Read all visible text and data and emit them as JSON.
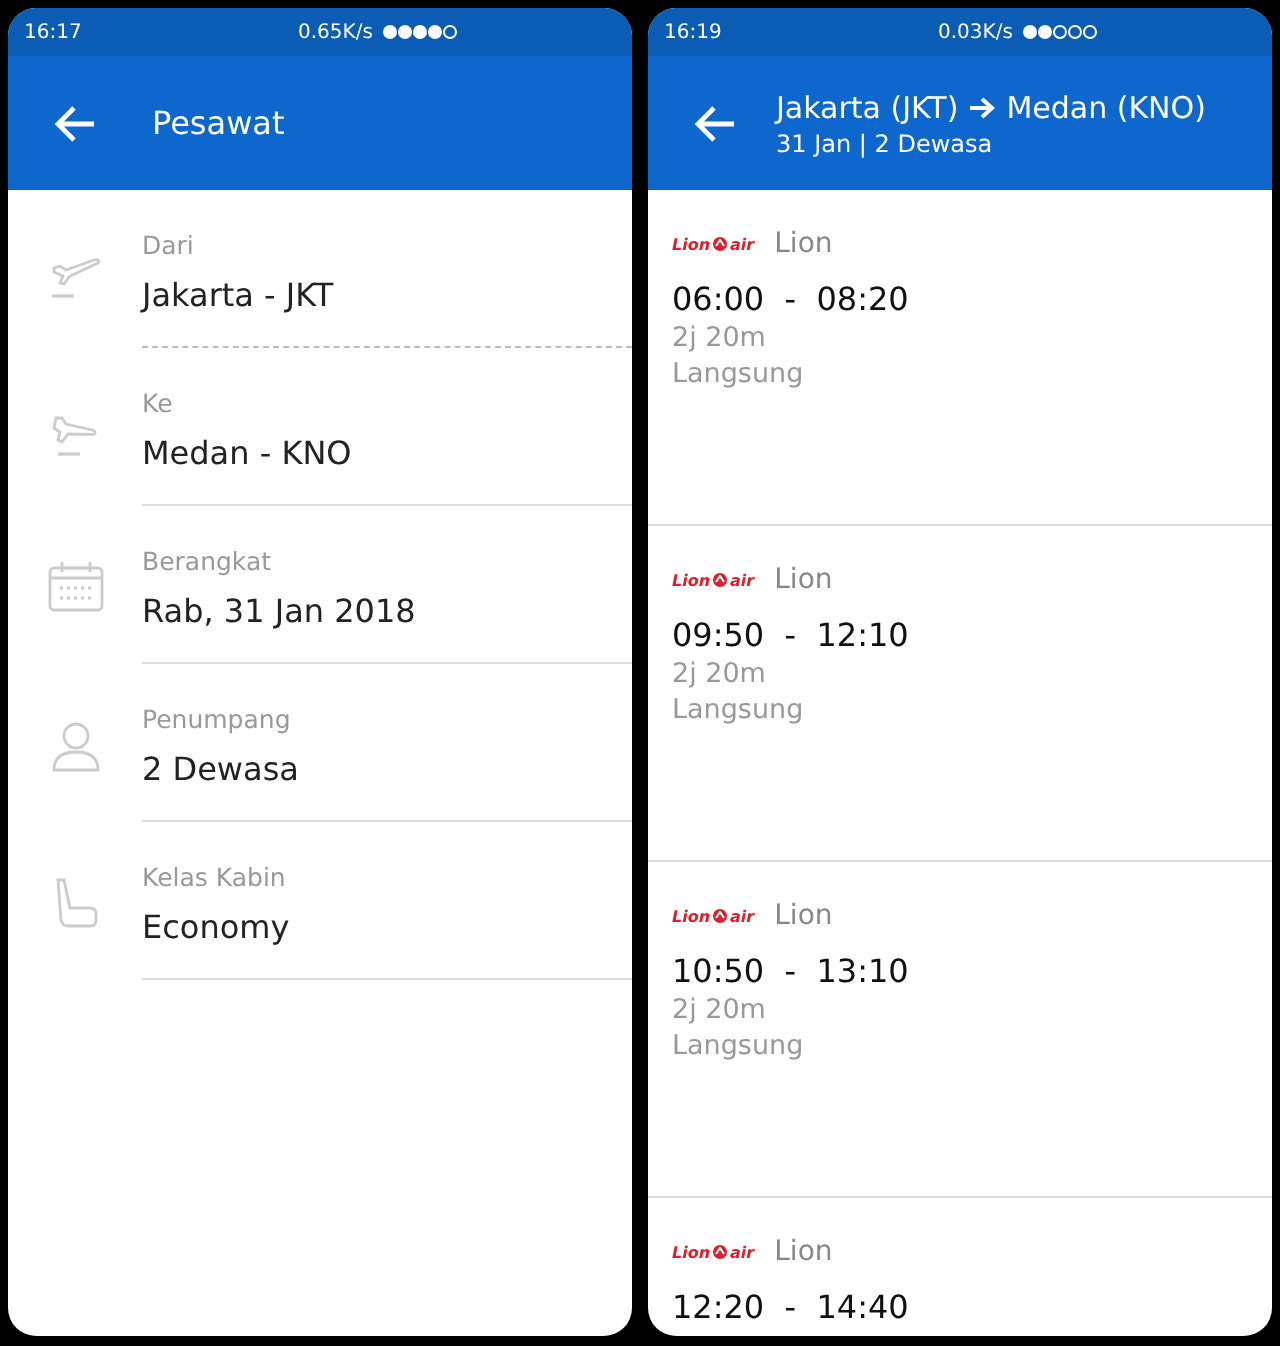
{
  "screens": [
    {
      "status_bar": {
        "time": "16:17",
        "speed": "0.65K/s"
      },
      "header": {
        "title": "Pesawat"
      },
      "form": [
        {
          "kind": "departure",
          "label": "Dari",
          "value": "Jakarta - JKT",
          "dashed": true
        },
        {
          "kind": "arrival",
          "label": "Ke",
          "value": "Medan - KNO",
          "dashed": false
        },
        {
          "kind": "calendar",
          "label": "Berangkat",
          "value": "Rab, 31 Jan 2018",
          "dashed": false
        },
        {
          "kind": "person",
          "label": "Penumpang",
          "value": "2 Dewasa",
          "dashed": false
        },
        {
          "kind": "seat",
          "label": "Kelas Kabin",
          "value": "Economy",
          "dashed": false
        }
      ]
    },
    {
      "status_bar": {
        "time": "16:19",
        "speed": "0.03K/s"
      },
      "header": {
        "from": "Jakarta (JKT)",
        "to": "Medan (KNO)",
        "subtitle": "31 Jan | 2 Dewasa"
      },
      "flights": [
        {
          "logo": [
            "Lion",
            "air"
          ],
          "airline": "Lion",
          "times": "06:00  -  08:20",
          "duration": "2j 20m",
          "stops": "Langsung"
        },
        {
          "logo": [
            "Lion",
            "air"
          ],
          "airline": "Lion",
          "times": "09:50  -  12:10",
          "duration": "2j 20m",
          "stops": "Langsung"
        },
        {
          "logo": [
            "Lion",
            "air"
          ],
          "airline": "Lion",
          "times": "10:50  -  13:10",
          "duration": "2j 20m",
          "stops": "Langsung"
        },
        {
          "logo": [
            "Lion",
            "air"
          ],
          "airline": "Lion",
          "times": "12:20  -  14:40"
        }
      ]
    }
  ]
}
